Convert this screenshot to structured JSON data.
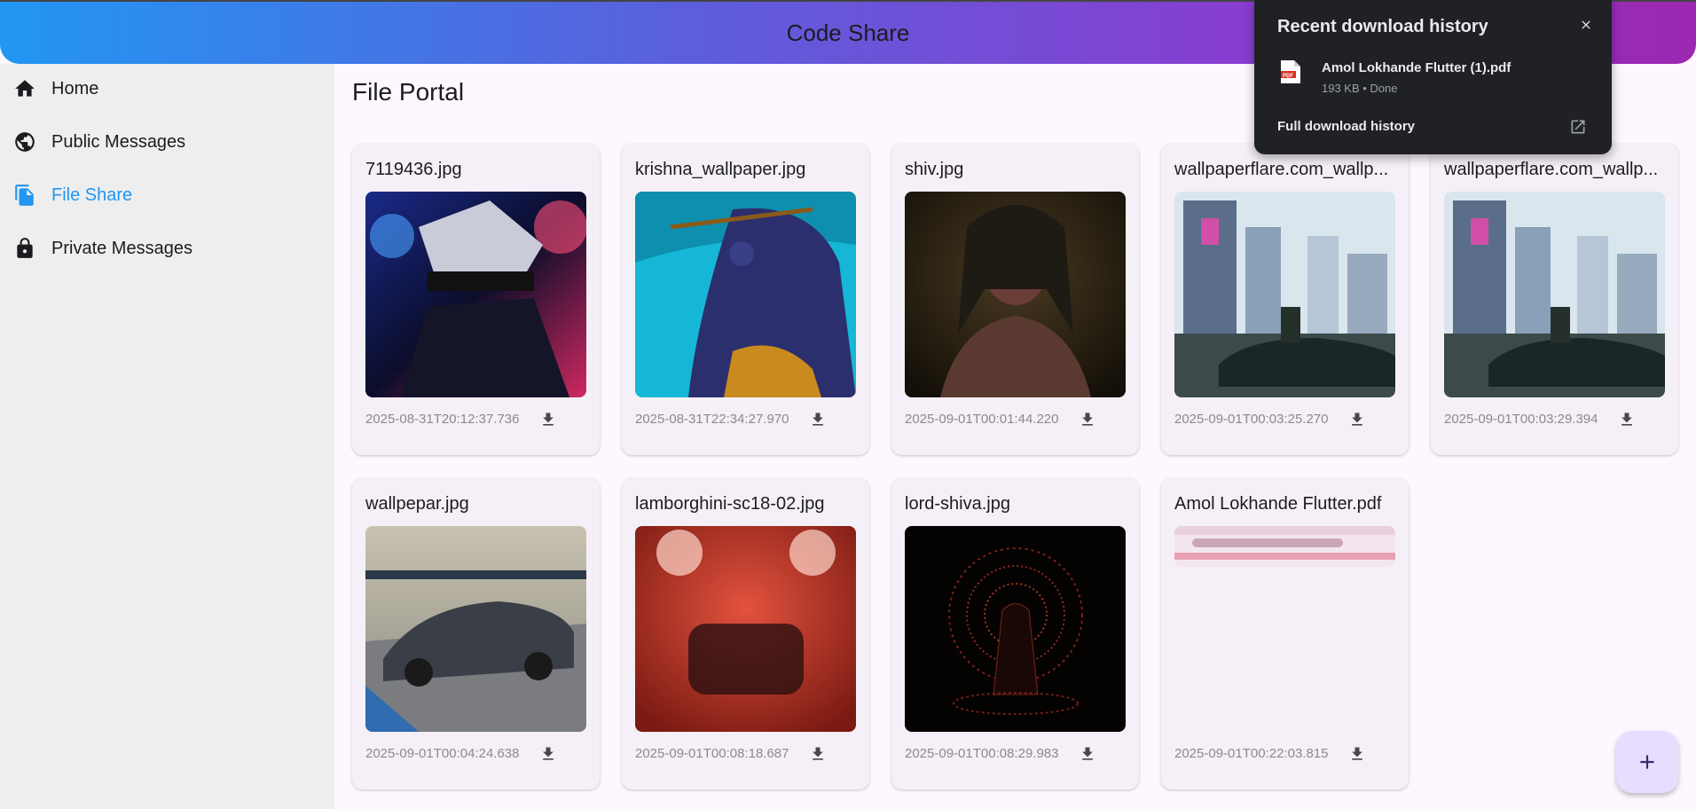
{
  "app": {
    "title": "Code Share"
  },
  "sidebar": {
    "items": [
      {
        "label": "Home",
        "icon": "home-icon"
      },
      {
        "label": "Public Messages",
        "icon": "globe-icon"
      },
      {
        "label": "File Share",
        "icon": "file-copy-icon",
        "active": true
      },
      {
        "label": "Private Messages",
        "icon": "lock-icon"
      }
    ],
    "active_color": "#2196f3"
  },
  "main": {
    "title": "File Portal",
    "files": [
      {
        "name": "7119436.jpg",
        "timestamp": "2025-08-31T20:12:37.736"
      },
      {
        "name": "krishna_wallpaper.jpg",
        "timestamp": "2025-08-31T22:34:27.970"
      },
      {
        "name": "shiv.jpg",
        "timestamp": "2025-09-01T00:01:44.220"
      },
      {
        "name": "wallpaperflare.com_wallp...",
        "timestamp": "2025-09-01T00:03:25.270"
      },
      {
        "name": "wallpaperflare.com_wallp...",
        "timestamp": "2025-09-01T00:03:29.394"
      },
      {
        "name": "wallpepar.jpg",
        "timestamp": "2025-09-01T00:04:24.638"
      },
      {
        "name": "lamborghini-sc18-02.jpg",
        "timestamp": "2025-09-01T00:08:18.687"
      },
      {
        "name": "lord-shiva.jpg",
        "timestamp": "2025-09-01T00:08:29.983"
      },
      {
        "name": "Amol Lokhande Flutter.pdf",
        "timestamp": "2025-09-01T00:22:03.815"
      }
    ]
  },
  "fab": {
    "icon": "plus-icon"
  },
  "download_popup": {
    "title": "Recent download history",
    "item": {
      "name": "Amol Lokhande Flutter (1).pdf",
      "meta": "193 KB • Done"
    },
    "full_history_label": "Full download history"
  }
}
